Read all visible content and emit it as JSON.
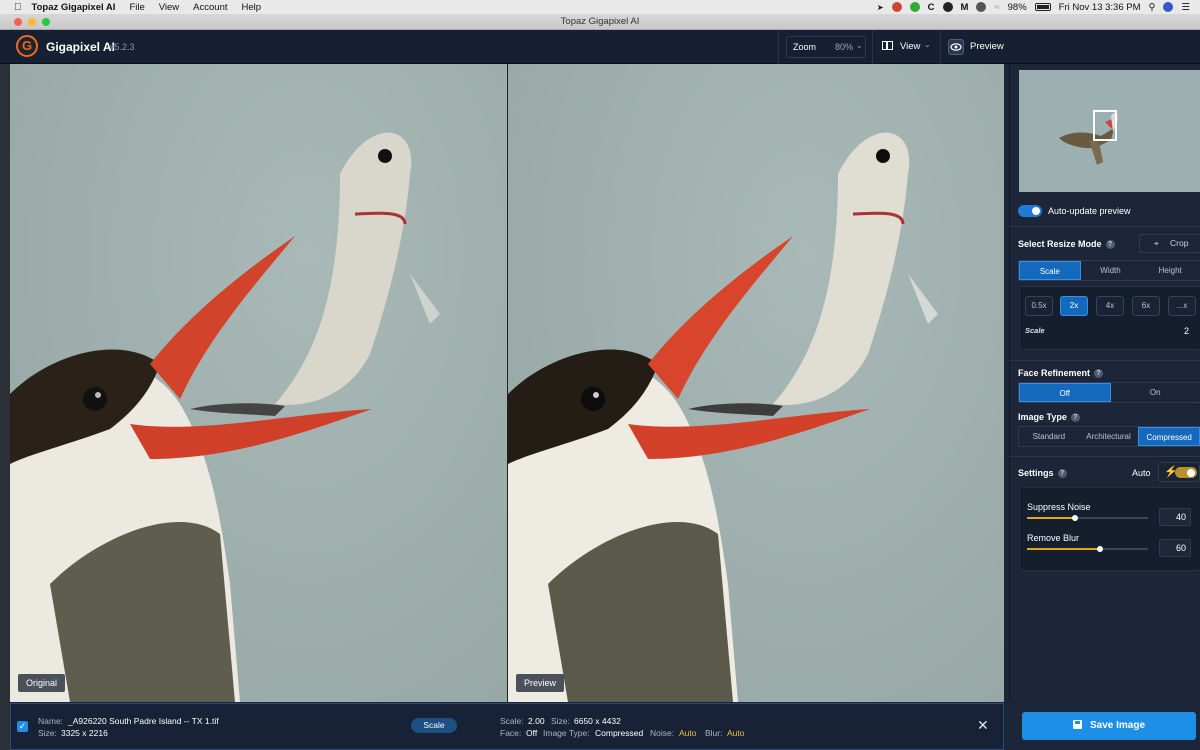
{
  "menubar": {
    "app_name": "Topaz Gigapixel AI",
    "items": [
      "File",
      "View",
      "Account",
      "Help"
    ],
    "battery": "98%",
    "datetime": "Fri Nov 13  3:36 PM"
  },
  "window": {
    "title": "Topaz Gigapixel AI"
  },
  "header": {
    "app_name": "Gigapixel AI",
    "version": "v5.2.3",
    "zoom_label": "Zoom",
    "zoom_value": "80%",
    "view_label": "View",
    "preview_label": "Preview"
  },
  "canvas": {
    "left_tag": "Original",
    "right_tag": "Preview"
  },
  "sidebar": {
    "auto_update_label": "Auto-update preview",
    "resize_mode_label": "Select Resize Mode",
    "crop_label": "Crop",
    "resize_tabs": [
      "Scale",
      "Width",
      "Height"
    ],
    "scale_chips": [
      "0.5x",
      "2x",
      "4x",
      "6x",
      "...x"
    ],
    "scale_label": "Scale",
    "scale_value": "2",
    "face_refinement_label": "Face Refinement",
    "face_options": [
      "Off",
      "On"
    ],
    "image_type_label": "Image Type",
    "image_types": [
      "Standard",
      "Architectural",
      "Compressed"
    ],
    "settings_label": "Settings",
    "auto_label": "Auto",
    "suppress_noise_label": "Suppress Noise",
    "suppress_noise_value": "40",
    "suppress_noise_level": 0.4,
    "remove_blur_label": "Remove Blur",
    "remove_blur_value": "60",
    "remove_blur_level": 0.6
  },
  "bottom": {
    "name_label": "Name:",
    "name_value": "_A926220 South Padre Island -- TX 1.tif",
    "size_label": "Size:",
    "size_value": "3325 x 2216",
    "scale_button": "Scale",
    "out_scale_label": "Scale:",
    "out_scale_value": "2.00",
    "out_size_label": "Size:",
    "out_size_value": "6650 x 4432",
    "face_label": "Face:",
    "face_value": "Off",
    "image_type_label": "Image Type:",
    "image_type_value": "Compressed",
    "noise_label": "Noise:",
    "noise_value": "Auto",
    "blur_label": "Blur:",
    "blur_value": "Auto"
  },
  "save_button": "Save Image"
}
